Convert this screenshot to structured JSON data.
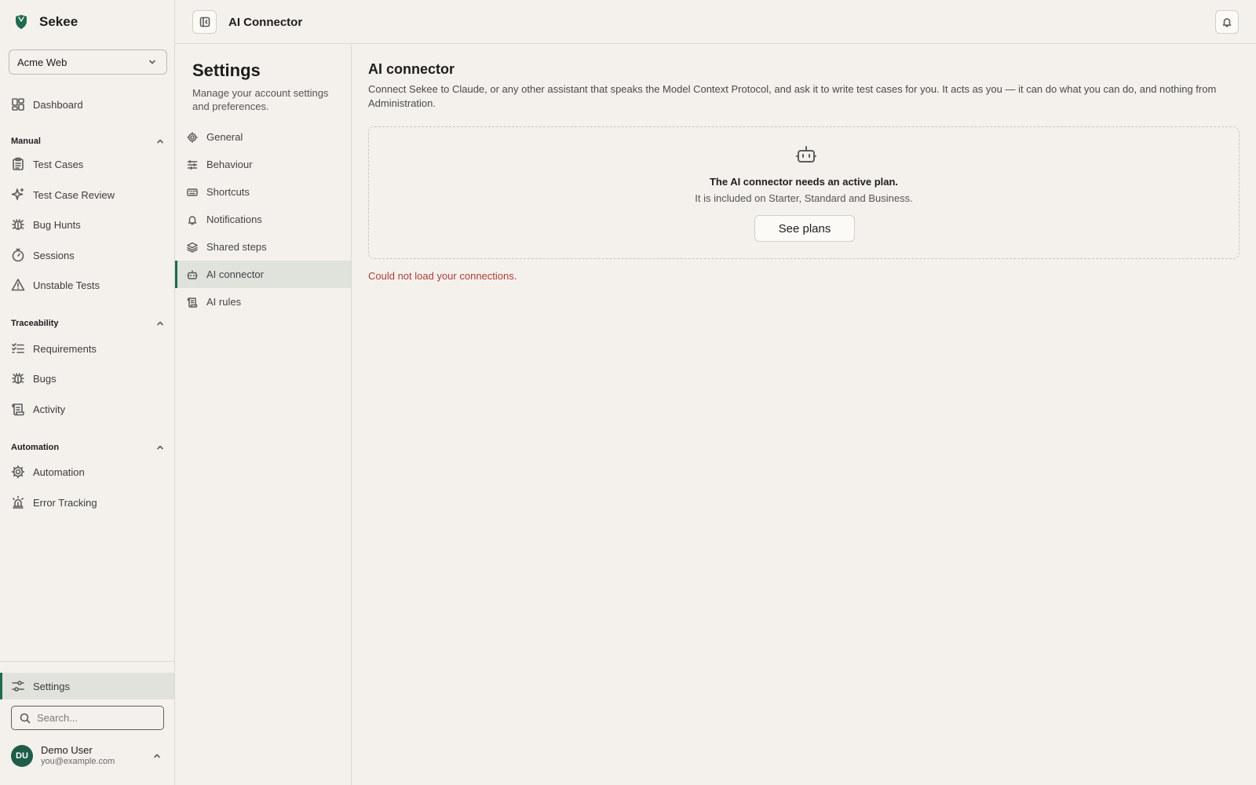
{
  "app": {
    "name": "Sekee"
  },
  "project_select": {
    "value": "Acme Web"
  },
  "sidebar": {
    "dashboard": "Dashboard",
    "sections": {
      "manual": "Manual",
      "traceability": "Traceability",
      "automation": "Automation"
    },
    "manual_items": [
      "Test Cases",
      "Test Case Review",
      "Bug Hunts",
      "Sessions",
      "Unstable Tests"
    ],
    "traceability_items": [
      "Requirements",
      "Bugs",
      "Activity"
    ],
    "automation_items": [
      "Automation",
      "Error Tracking"
    ],
    "settings": "Settings",
    "search_placeholder": "Search...",
    "user": {
      "initials": "DU",
      "name": "Demo User",
      "email": "you@example.com"
    }
  },
  "header": {
    "title": "AI Connector"
  },
  "settings": {
    "title": "Settings",
    "subtitle": "Manage your account settings and preferences.",
    "items": [
      "General",
      "Behaviour",
      "Shortcuts",
      "Notifications",
      "Shared steps",
      "AI connector",
      "AI rules"
    ],
    "active": "AI connector"
  },
  "main": {
    "title": "AI connector",
    "description": "Connect Sekee to Claude, or any other assistant that speaks the Model Context Protocol, and ask it to write test cases for you. It acts as you — it can do what you can do, and nothing from Administration.",
    "plan_message": "The AI connector needs an active plan.",
    "plan_sub": "It is included on Starter, Standard and Business.",
    "plans_button": "See plans",
    "error": "Could not load your connections."
  },
  "colors": {
    "accent": "#1f6b50",
    "error": "#b23b3b",
    "background": "#f4f1ec"
  }
}
